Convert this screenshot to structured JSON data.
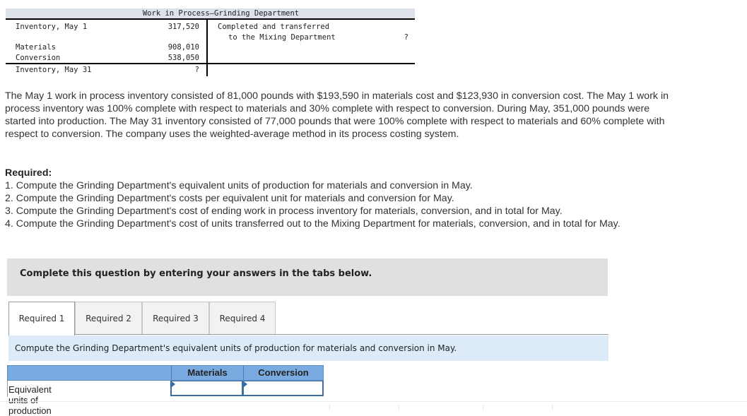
{
  "t_account": {
    "title": "Work in Process—Grinding Department",
    "debits": [
      {
        "label": "Inventory, May 1",
        "value": "317,520"
      },
      {
        "label": "Materials",
        "value": "908,010"
      },
      {
        "label": "Conversion",
        "value": "538,050"
      }
    ],
    "ending": {
      "label": "Inventory, May 31",
      "value": "?"
    },
    "credit": {
      "line1": "Completed and transferred",
      "line2": "to the Mixing Department",
      "value": "?"
    }
  },
  "problem": {
    "paragraph": "The May 1 work in process inventory consisted of 81,000 pounds with $193,590 in materials cost and $123,930 in conversion cost. The May 1 work in process inventory was 100% complete with respect to materials and 30% complete with respect to conversion. During May, 351,000 pounds were started into production. The May 31 inventory consisted of 77,000 pounds that were 100% complete with respect to materials and 60% complete with respect to conversion. The company uses the weighted-average method in its process costing system."
  },
  "required": {
    "heading": "Required:",
    "items": [
      "1. Compute the Grinding Department's equivalent units of production for materials and conversion in May.",
      "2. Compute the Grinding Department's costs per equivalent unit for materials and conversion for May.",
      "3. Compute the Grinding Department's cost of ending work in process inventory for materials, conversion, and in total for May.",
      "4. Compute the Grinding Department's cost of units transferred out to the Mixing Department for materials, conversion, and in total for May."
    ]
  },
  "banner": {
    "text": "Complete this question by entering your answers in the tabs below."
  },
  "tabs": [
    {
      "label": "Required 1",
      "active": true
    },
    {
      "label": "Required 2",
      "active": false
    },
    {
      "label": "Required 3",
      "active": false
    },
    {
      "label": "Required 4",
      "active": false
    }
  ],
  "tab_content": {
    "prompt": "Compute the Grinding Department's equivalent units of production for materials and conversion in May.",
    "table": {
      "columns": [
        "",
        "Materials",
        "Conversion"
      ],
      "rows": [
        {
          "label": "Equivalent units of production",
          "materials": "",
          "conversion": ""
        }
      ]
    }
  },
  "colors": {
    "t_account_header_bg": "#dde1ea",
    "banner_bg": "#e0e0e0",
    "prompt_bg": "#dcebf7",
    "table_header_bg": "#7aabe0",
    "input_border": "#3f6d9e"
  }
}
